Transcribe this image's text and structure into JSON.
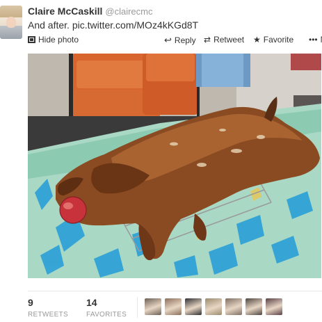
{
  "tweet": {
    "author_name": "Claire McCaskill",
    "author_handle": "@clairecmc",
    "text": "And after. pic.twitter.com/MOz4kKGd8T"
  },
  "actions": {
    "hide_photo": "Hide photo",
    "reply": "Reply",
    "retweet": "Retweet",
    "favorite": "Favorite",
    "more": "Mo"
  },
  "stats": {
    "retweets_count": "9",
    "retweets_label": "RETWEETS",
    "favorites_count": "14",
    "favorites_label": "FAVORITES"
  },
  "favoriters": [
    {
      "color": "#6b5f55"
    },
    {
      "color": "#8a6f5a"
    },
    {
      "color": "#2f2f33"
    },
    {
      "color": "#9a8b6e"
    },
    {
      "color": "#7e6f63"
    },
    {
      "color": "#4e4540"
    },
    {
      "color": "#5a3f45"
    }
  ],
  "photo": {
    "subject": "roasted whole pig with apple on a grill over a green patterned towel"
  }
}
